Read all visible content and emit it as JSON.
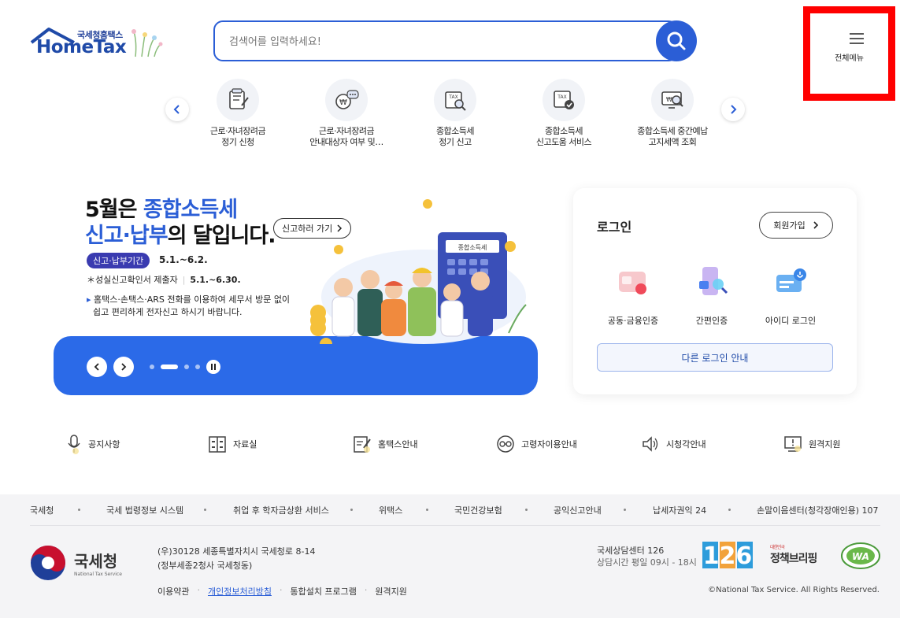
{
  "header": {
    "logo_small": "국세청홈택스",
    "logo_big": "HomeTax",
    "search_placeholder": "검색어를 입력하세요!",
    "menu_label": "전체메뉴",
    "highlight_color": "#ff0000"
  },
  "quick_menu": {
    "items": [
      {
        "label1": "근로·자녀장려금",
        "label2": "정기 신청",
        "icon": "document-pen-icon"
      },
      {
        "label1": "근로·자녀장려금",
        "label2": "안내대상자 여부 및…",
        "icon": "won-chat-icon"
      },
      {
        "label1": "종합소득세",
        "label2": "정기 신고",
        "icon": "tax-search-icon"
      },
      {
        "label1": "종합소득세",
        "label2": "신고도움 서비스",
        "icon": "tax-check-icon"
      },
      {
        "label1": "종합소득세 중간예납",
        "label2": "고지세액 조회",
        "icon": "monitor-search-icon"
      }
    ]
  },
  "banner": {
    "title1_a": "5월은 ",
    "title1_b": "종합소득세",
    "title2_a": "신고·납부",
    "title2_b": "의 달입니다.",
    "go_label": "신고하러 가기",
    "badge": "신고·납부기간",
    "date1": "5.1.~6.2.",
    "line2_label": "＊성실신고확인서 제출자",
    "line2_date": "5.1.~6.30.",
    "line3a": "홈택스·손택스·ARS 전화를 이용하여 세무서 방문 없이",
    "line3b": "쉽고 편리하게 전자신고 하시기 바랍니다.",
    "calculator_label": "종합소득세",
    "accent": "#2b6ae8"
  },
  "login": {
    "title": "로그인",
    "join": "회원가입",
    "options": [
      "공동·금융인증",
      "간편인증",
      "아이디 로그인"
    ],
    "other": "다른 로그인 안내"
  },
  "shortcuts": [
    {
      "label": "공지사항",
      "icon": "microphone-icon"
    },
    {
      "label": "자료실",
      "icon": "cabinet-icon"
    },
    {
      "label": "홈택스안내",
      "icon": "notepad-icon"
    },
    {
      "label": "고령자이용안내",
      "icon": "glasses-icon"
    },
    {
      "label": "시청각안내",
      "icon": "speaker-icon"
    },
    {
      "label": "원격지원",
      "icon": "remote-monitor-icon"
    }
  ],
  "footer": {
    "links": [
      "국세청",
      "국세 법령정보 시스템",
      "취업 후 학자금상환 서비스",
      "위택스",
      "국민건강보험",
      "공익신고안내",
      "납세자권익 24",
      "손말이음센터(청각장애인용) 107"
    ],
    "nts_name": "국세청",
    "nts_sub": "National Tax Service",
    "address1": "(우)30128 세종특별자치시 국세청로 8-14",
    "address2": "(정부세종2청사 국세청동)",
    "bottom_links": [
      "이용약관",
      "개인정보처리방침",
      "통합설치 프로그램",
      "원격지원"
    ],
    "call_center": "국세상담센터 126",
    "call_hours": "상담시간 평일 09시 - 18시",
    "badge_126": "126",
    "policy_small": "대한민국",
    "policy": "정책브리핑",
    "wa": "WA",
    "copyright": "©National Tax Service. All Rights Reserved."
  }
}
